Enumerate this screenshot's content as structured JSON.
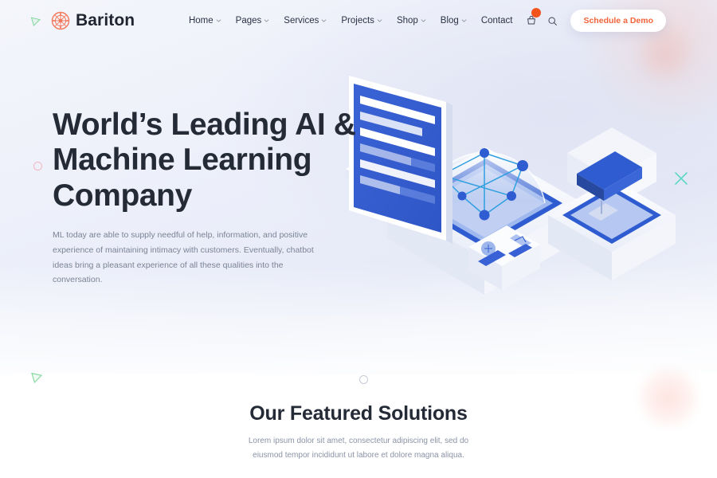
{
  "brand": {
    "name": "Bariton",
    "logo_icon": "circuit-chip-icon",
    "logo_color": "#f4765a"
  },
  "decorations": {
    "triangle_top_left": "triangle-outline-green-icon",
    "triangle_bottom_left": "triangle-outline-green-icon",
    "circle_left": "circle-outline-pink-icon",
    "circle_center": "circle-outline-grey-icon",
    "x_mark_right": "x-mark-teal-icon",
    "green": "#7fd89b",
    "pink": "#f0b8c4",
    "teal": "#5fd8c8",
    "grey": "#c6cad6"
  },
  "nav": {
    "items": [
      {
        "label": "Home",
        "has_dropdown": true
      },
      {
        "label": "Pages",
        "has_dropdown": true
      },
      {
        "label": "Services",
        "has_dropdown": true
      },
      {
        "label": "Projects",
        "has_dropdown": true
      },
      {
        "label": "Shop",
        "has_dropdown": true
      },
      {
        "label": "Blog",
        "has_dropdown": true
      },
      {
        "label": "Contact",
        "has_dropdown": false
      }
    ],
    "cart_icon": "shopping-cart-icon",
    "cart_badge": "",
    "cart_badge_color": "#f2541b",
    "search_icon": "search-icon",
    "cta": {
      "label": "Schedule a Demo",
      "text_color": "#f4633a",
      "background": "#ffffff"
    }
  },
  "hero": {
    "title": "World’s Leading AI & Machine Learning Company",
    "description": "ML today are able to supply needful of help, information, and positive experience of maintaining intimacy with customers. Eventually, chatbot ideas bring a pleasant experience of all these qualities into the conversation.",
    "illustration": "isometric-ai-machine-learning-illustration"
  },
  "featured": {
    "title": "Our Featured Solutions",
    "subtitle": "Lorem ipsum dolor sit amet, consectetur adipiscing elit, sed do eiusmod tempor incididunt ut labore et dolore magna aliqua."
  },
  "theme": {
    "text_dark": "#242a36",
    "text_muted": "#7b8395",
    "accent_orange": "#f4633a",
    "illustration_blue": "#3761d4",
    "illustration_light_blue": "#a9bdf0"
  }
}
